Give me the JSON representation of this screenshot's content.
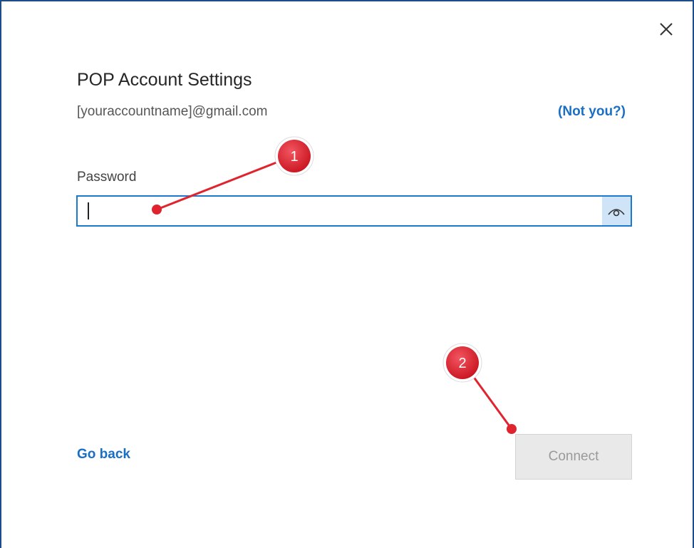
{
  "dialog": {
    "title": "POP Account Settings",
    "email": "[youraccountname]@gmail.com",
    "not_you_label": "(Not you?)",
    "close_icon": "close-icon"
  },
  "password": {
    "label": "Password",
    "value": "",
    "reveal_icon": "eye-icon"
  },
  "footer": {
    "go_back_label": "Go back",
    "connect_label": "Connect",
    "connect_enabled": false
  },
  "annotations": {
    "badge_1": "1",
    "badge_2": "2",
    "color": "#e0242f"
  },
  "colors": {
    "accent": "#1c79d2",
    "link": "#1a6fc4",
    "disabled_button_bg": "#e9e9e9",
    "disabled_button_text": "#9a9a9a"
  }
}
